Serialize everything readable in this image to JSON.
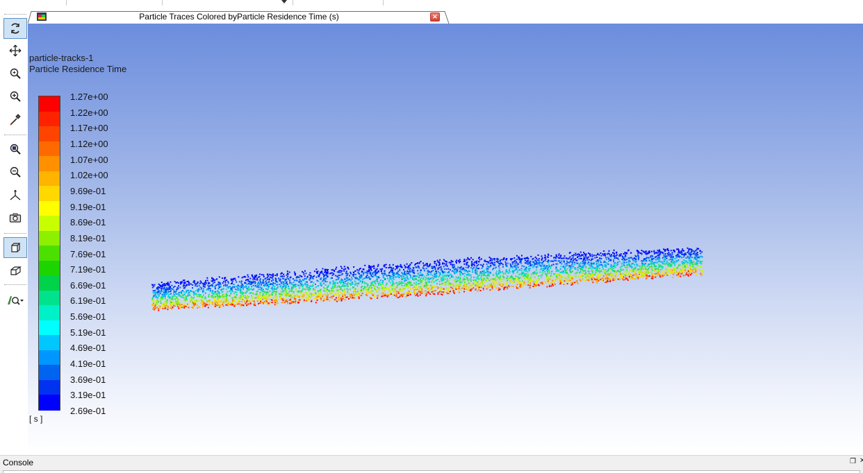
{
  "tab": {
    "title": "Particle Traces Colored byParticle Residence Time (s)",
    "close_label": "×"
  },
  "viewport": {
    "object_name": "particle-tracks-1",
    "variable_name": "Particle Residence Time",
    "unit": "[ s ]"
  },
  "colormap": {
    "labels": [
      "1.27e+00",
      "1.22e+00",
      "1.17e+00",
      "1.12e+00",
      "1.07e+00",
      "1.02e+00",
      "9.69e-01",
      "9.19e-01",
      "8.69e-01",
      "8.19e-01",
      "7.69e-01",
      "7.19e-01",
      "6.69e-01",
      "6.19e-01",
      "5.69e-01",
      "5.19e-01",
      "4.69e-01",
      "4.19e-01",
      "3.69e-01",
      "3.19e-01",
      "2.69e-01"
    ],
    "colors": [
      "#ff0000",
      "#ff2200",
      "#ff4400",
      "#ff6a00",
      "#ff9000",
      "#ffb400",
      "#ffd800",
      "#ffff00",
      "#c8ff00",
      "#8cf000",
      "#4ce000",
      "#1cd400",
      "#00d24a",
      "#00e28c",
      "#00f0c8",
      "#00ffff",
      "#00c8ff",
      "#0096ff",
      "#0064f0",
      "#0032f0",
      "#0000ff"
    ]
  },
  "toolbar": {
    "tools": [
      "rotate-icon",
      "pan-icon",
      "zoom-icon",
      "zoom-in-icon",
      "probe-icon",
      "zoom-to-fit-icon",
      "zoom-out-icon",
      "axes-icon",
      "camera-icon",
      "orthographic-view-icon",
      "perspective-view-icon",
      "display-options-icon"
    ]
  },
  "console": {
    "label": "Console",
    "restore_icon": "restore-icon",
    "close_icon": "close-icon"
  }
}
